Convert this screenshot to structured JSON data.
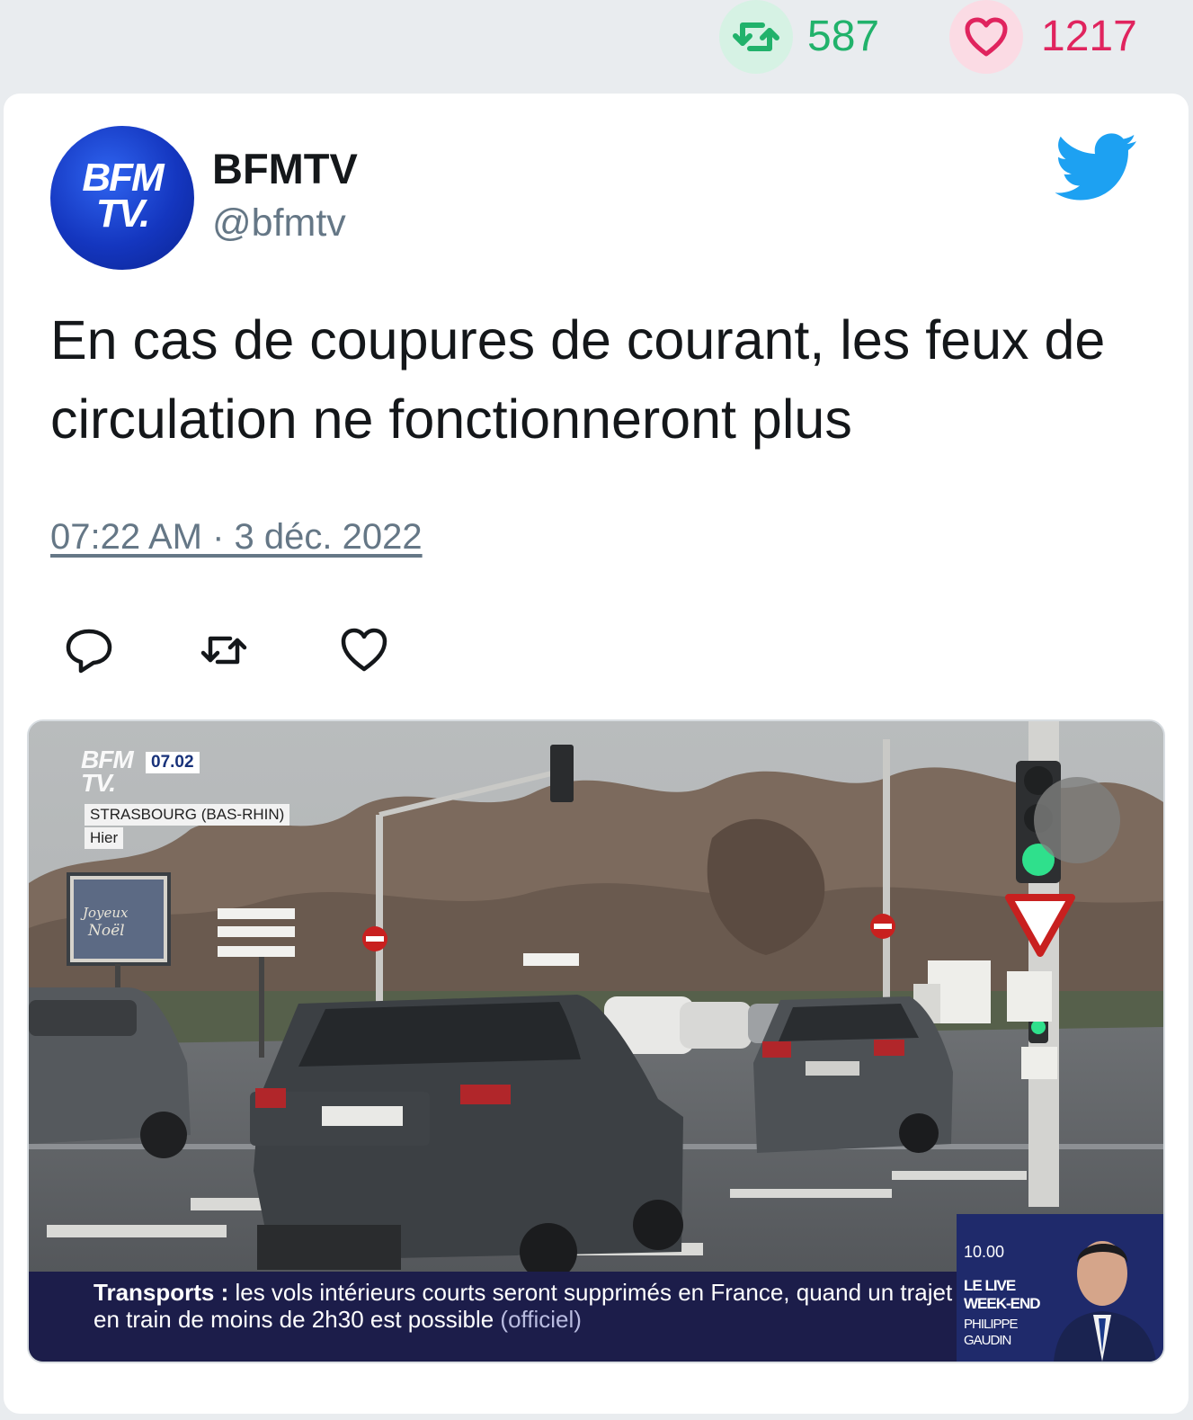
{
  "stats": {
    "retweet_count": "587",
    "like_count": "1217"
  },
  "tweet": {
    "avatar_text_line1": "BFM",
    "avatar_text_line2": "TV.",
    "display_name": "BFMTV",
    "handle": "@bfmtv",
    "text": "En cas de coupures de courant, les feux de circulation ne fonctionneront plus",
    "timestamp": "07:22 AM · 3 déc. 2022"
  },
  "media": {
    "channel_logo_line1": "BFM",
    "channel_logo_line2": "TV.",
    "clock": "07.02",
    "location": "STRASBOURG (BAS-RHIN)",
    "when": "Hier",
    "billboard": "Joyeux Noël",
    "ticker_label": "Transports :",
    "ticker_text": " les vols intérieurs courts seront supprimés en France, quand un trajet en train de moins de 2h30 est possible ",
    "ticker_source": "(officiel)",
    "side_time": "10.00",
    "side_show": "LE LIVE WEEK-END",
    "side_host": "PHILIPPE GAUDIN"
  },
  "icons": {
    "retweet": "retweet-icon",
    "like": "heart-icon",
    "reply": "reply-icon",
    "bird": "twitter-bird-icon"
  },
  "colors": {
    "retweet_green": "#21b26b",
    "like_red": "#e0245e",
    "twitter_blue": "#1da1f2",
    "text_secondary": "#657786",
    "ticker_bg": "#1c1d4a"
  }
}
